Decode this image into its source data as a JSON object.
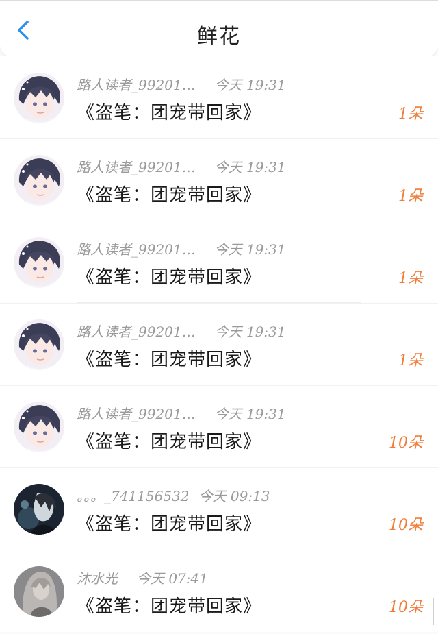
{
  "header": {
    "title": "鲜花",
    "back_icon": "chevron-left-icon",
    "accent": "#2a8ff0"
  },
  "items": [
    {
      "user": "路人读者_99201…",
      "time": "今天 19:31",
      "book": "《盗笔：团宠带回家》",
      "count": "1朵",
      "avatar": "anime-boy"
    },
    {
      "user": "路人读者_99201…",
      "time": "今天 19:31",
      "book": "《盗笔：团宠带回家》",
      "count": "1朵",
      "avatar": "anime-boy"
    },
    {
      "user": "路人读者_99201…",
      "time": "今天 19:31",
      "book": "《盗笔：团宠带回家》",
      "count": "1朵",
      "avatar": "anime-boy"
    },
    {
      "user": "路人读者_99201…",
      "time": "今天 19:31",
      "book": "《盗笔：团宠带回家》",
      "count": "1朵",
      "avatar": "anime-boy"
    },
    {
      "user": "路人读者_99201…",
      "time": "今天 19:31",
      "book": "《盗笔：团宠带回家》",
      "count": "10朵",
      "avatar": "anime-boy"
    },
    {
      "user": "。。。_741156532",
      "time": "今天 09:13",
      "book": "《盗笔：团宠带回家》",
      "count": "10朵",
      "avatar": "dark-figure"
    },
    {
      "user": "沐水光",
      "time": "今天 07:41",
      "book": "《盗笔：团宠带回家》",
      "count": "10朵",
      "avatar": "grey-girl"
    }
  ],
  "colors": {
    "count": "#f07d3a",
    "meta": "#9a9a9a",
    "book": "#1a1a1a"
  }
}
